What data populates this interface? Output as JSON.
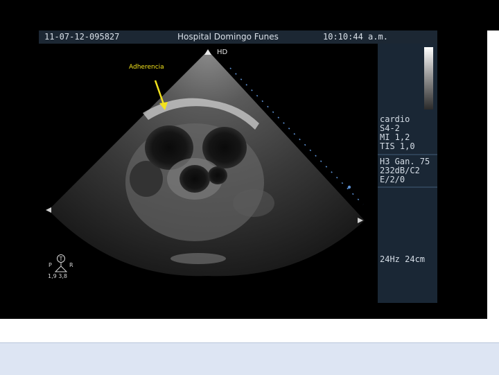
{
  "header": {
    "study_id": "11-07-12-095827",
    "hospital": "Hospital Domingo Funes",
    "time": "10:10:44 a.m."
  },
  "image": {
    "annotation_label": "Adherencia",
    "probe_marker": "HD",
    "annotation_color": "#f2e21c"
  },
  "side_panel": {
    "preset": "cardio",
    "probe": "S4-2",
    "mi": "MI 1,2",
    "tis": "TIS 1,0",
    "harmonic_gain": "H3 Gan. 75",
    "dynamic_range": "232dB/C2",
    "persistence": "E/2/0",
    "rate_depth": "24Hz 24cm"
  },
  "orientation": {
    "center_label": "T",
    "left_label": "P",
    "right_label": "R",
    "values": "1,9  3,8"
  }
}
